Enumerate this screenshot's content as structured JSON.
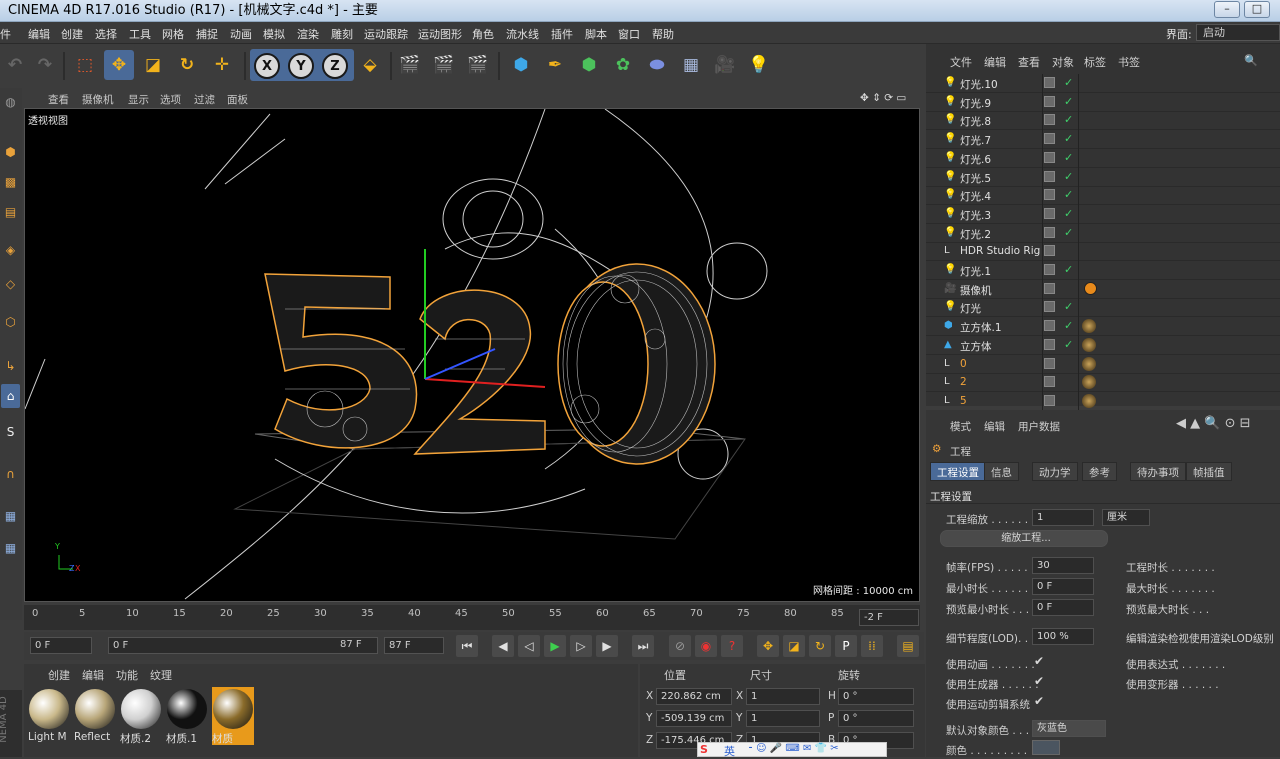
{
  "window": {
    "title": "CINEMA 4D R17.016 Studio (R17) - [机械文字.c4d *] - 主要",
    "min_label": "–",
    "max_label": "□"
  },
  "menu": [
    "件",
    "编辑",
    "创建",
    "选择",
    "工具",
    "网格",
    "捕捉",
    "动画",
    "模拟",
    "渲染",
    "雕刻",
    "运动跟踪",
    "运动图形",
    "角色",
    "流水线",
    "插件",
    "脚本",
    "窗口",
    "帮助"
  ],
  "layout": {
    "label": "界面:",
    "value": "启动"
  },
  "viewport_menu": [
    "查看",
    "摄像机",
    "显示",
    "选项",
    "过滤",
    "面板"
  ],
  "viewport": {
    "name": "透视视图",
    "grid_info": "网格间距 : 10000 cm",
    "scene_text": "520",
    "axis_y": "Y",
    "axis_z": "Z",
    "axis_x": "X"
  },
  "timeline": {
    "ticks": [
      "0",
      "5",
      "10",
      "15",
      "20",
      "25",
      "30",
      "35",
      "40",
      "45",
      "50",
      "55",
      "60",
      "65",
      "70",
      "75",
      "80",
      "85"
    ],
    "end_field": "-2 F"
  },
  "playback": {
    "start": "0 F",
    "current": "0 F",
    "range_end": "87 F",
    "end": "87 F"
  },
  "materials": {
    "menu": [
      "创建",
      "编辑",
      "功能",
      "纹理"
    ],
    "items": [
      {
        "label": "Light M",
        "color": "#c9b88a"
      },
      {
        "label": "Reflect",
        "color": "#b8a679"
      },
      {
        "label": "材质.2",
        "color": "#d0d0d0"
      },
      {
        "label": "材质.1",
        "color": "#111111"
      },
      {
        "label": "材质",
        "color": "#8a6b2a"
      }
    ],
    "side_label": "NEMA 4D"
  },
  "coords": {
    "headers": [
      "位置",
      "尺寸",
      "旋转"
    ],
    "rows": [
      {
        "axis": "X",
        "pos": "220.862 cm",
        "saxis": "X",
        "size": "1",
        "raxis": "H",
        "rot": "0 °"
      },
      {
        "axis": "Y",
        "pos": "-509.139 cm",
        "saxis": "Y",
        "size": "1",
        "raxis": "P",
        "rot": "0 °"
      },
      {
        "axis": "Z",
        "pos": "-175.446 cm",
        "saxis": "Z",
        "size": "1",
        "raxis": "B",
        "rot": "0 °"
      }
    ]
  },
  "objects": {
    "menu": [
      "文件",
      "编辑",
      "查看",
      "对象",
      "标签",
      "书签"
    ],
    "items": [
      {
        "name": "灯光.10",
        "type": "light",
        "check": true
      },
      {
        "name": "灯光.9",
        "type": "light",
        "check": true
      },
      {
        "name": "灯光.8",
        "type": "light",
        "check": true
      },
      {
        "name": "灯光.7",
        "type": "light",
        "check": true
      },
      {
        "name": "灯光.6",
        "type": "light",
        "check": true
      },
      {
        "name": "灯光.5",
        "type": "light",
        "check": true
      },
      {
        "name": "灯光.4",
        "type": "light",
        "check": true
      },
      {
        "name": "灯光.3",
        "type": "light",
        "check": true
      },
      {
        "name": "灯光.2",
        "type": "light",
        "check": true
      },
      {
        "name": "HDR Studio Rig",
        "type": "null",
        "check": false
      },
      {
        "name": "灯光.1",
        "type": "light",
        "check": true
      },
      {
        "name": "摄像机",
        "type": "camera",
        "check": false
      },
      {
        "name": "灯光",
        "type": "light",
        "check": true
      },
      {
        "name": "立方体.1",
        "type": "cube",
        "check": true
      },
      {
        "name": "立方体",
        "type": "cone",
        "check": true
      },
      {
        "name": "0",
        "type": "null-orange",
        "check": false
      },
      {
        "name": "2",
        "type": "null-orange",
        "check": false
      },
      {
        "name": "5",
        "type": "null-orange",
        "check": false
      }
    ]
  },
  "attributes": {
    "menu": [
      "模式",
      "编辑",
      "用户数据"
    ],
    "header": "工程",
    "tabs": [
      "工程设置",
      "信息",
      "动力学",
      "参考",
      "待办事项",
      "帧插值"
    ],
    "section": "工程设置",
    "scale_label": "工程缩放 . . . . . . .",
    "scale_value": "1",
    "scale_unit": "厘米",
    "scale_button": "缩放工程...",
    "fps_label": "帧率(FPS) . . . . . .",
    "fps": "30",
    "duration_label": "工程时长 . . . . . . .",
    "min_label": "最小时长 . . . . . . .",
    "min": "0 F",
    "max_label": "最大时长 . . . . . . .",
    "pmin_label": "预览最小时长 . . .",
    "pmin": "0 F",
    "pmax_label": "预览最大时长 . . .",
    "lod_label": "细节程度(LOD). . . .",
    "lod": "100 %",
    "lod_render_label": "编辑渲染检视使用渲染LOD级别",
    "use_anim": "使用动画 . . . . . . .",
    "use_expr": "使用表达式 . . . . . . .",
    "use_gen": "使用生成器 . . . . . .",
    "use_deform": "使用变形器 . . . . . .",
    "use_motion": "使用运动剪辑系统",
    "def_color_label": "默认对象颜色 . . .",
    "def_color": "灰蓝色",
    "color_label": "颜色 . . . . . . . . ."
  },
  "ime": {
    "label": "英"
  }
}
